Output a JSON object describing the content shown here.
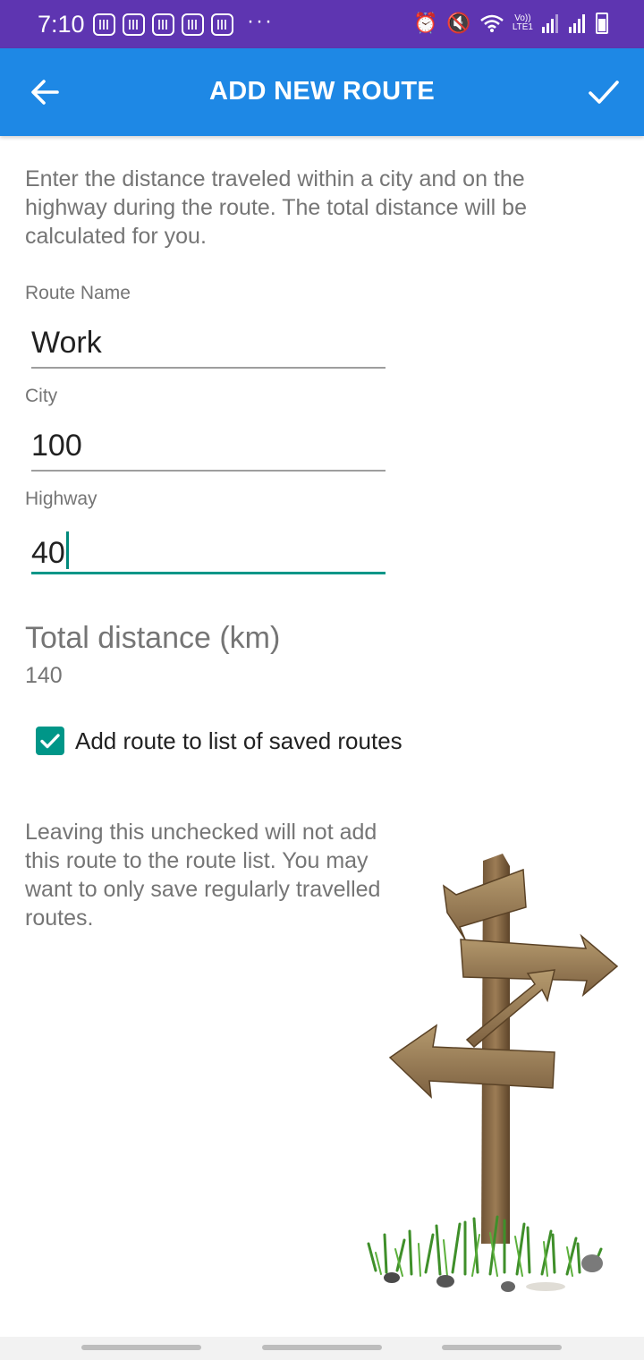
{
  "status_bar": {
    "time": "7:10",
    "more": "···",
    "volte": "Vo))",
    "lte": "LTE1"
  },
  "app_bar": {
    "title": "ADD NEW ROUTE",
    "back_icon": "arrow-back-icon",
    "confirm_icon": "check-icon",
    "color": "#1e88e5"
  },
  "intro_text": "Enter the distance traveled within a city and on the highway during the route. The total distance will be calculated for you.",
  "form": {
    "route_name": {
      "label": "Route Name",
      "value": "Work"
    },
    "city": {
      "label": "City",
      "value": "100"
    },
    "highway": {
      "label": "Highway",
      "value": "40"
    }
  },
  "total": {
    "label": "Total distance (km)",
    "value": "140"
  },
  "save_checkbox": {
    "label": "Add route to list of saved routes",
    "checked": true,
    "color": "#009688"
  },
  "note_text": "Leaving this unchecked will not add this route to the route list. You may want to only save regularly travelled routes.",
  "illustration": "wooden-signpost-illustration"
}
